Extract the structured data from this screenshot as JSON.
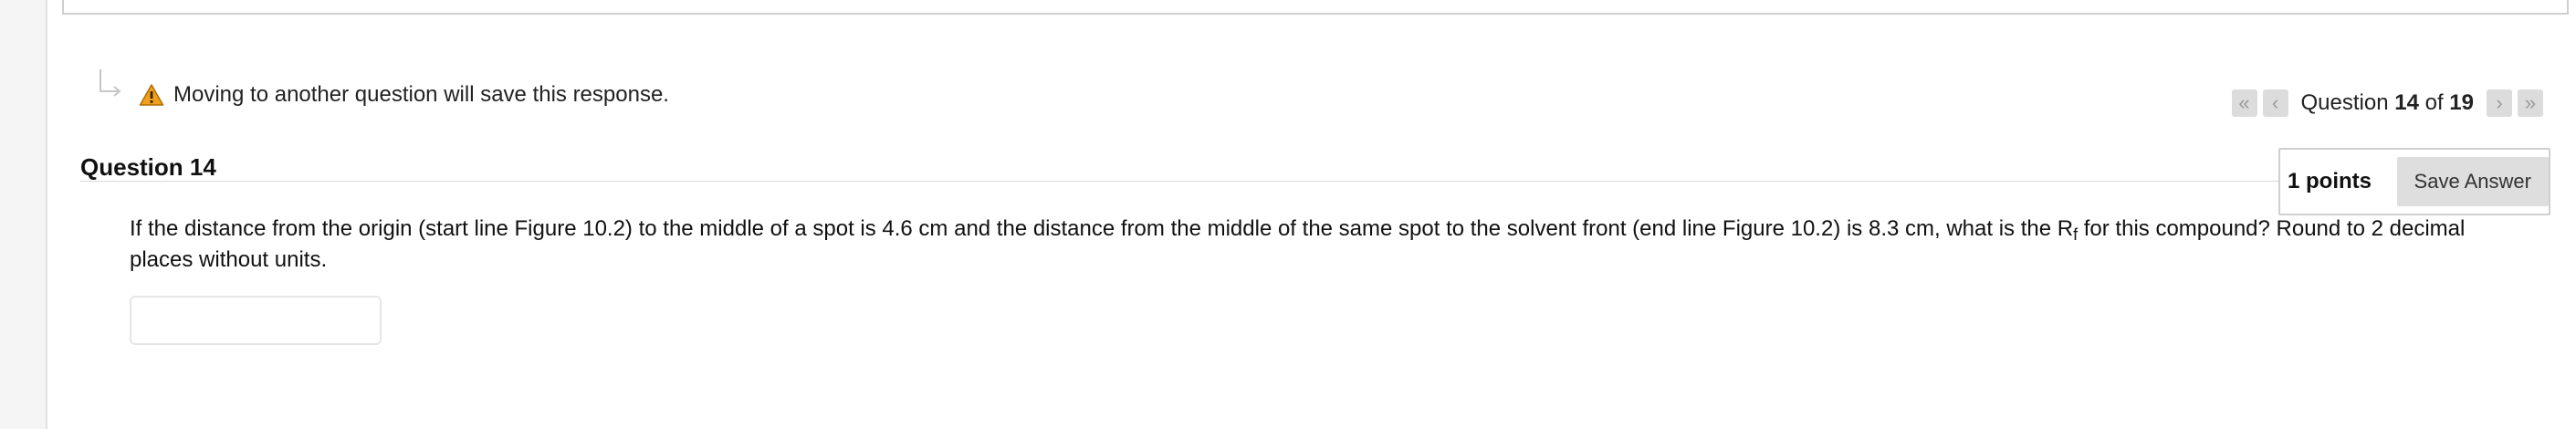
{
  "warning": {
    "text": "Moving to another question will save this response.",
    "icon": "warning-triangle",
    "icon_color": "#f0a020"
  },
  "pager": {
    "prefix": "Question",
    "current": "14",
    "of_label": "of",
    "total": "19",
    "first_icon": "double-chevron-left",
    "prev_icon": "chevron-left",
    "next_icon": "chevron-right",
    "last_icon": "double-chevron-right"
  },
  "question": {
    "title": "Question 14",
    "points": "1 points",
    "save_label": "Save Answer",
    "text_before_sub": "If the distance from the origin (start line Figure 10.2) to the middle of a spot is 4.6 cm and the distance from the middle of the same spot to the solvent front (end line Figure 10.2) is 8.3 cm, what is the R",
    "subscript": "f",
    "text_after_sub": " for this compound?  Round to 2 decimal places without units.",
    "answer_value": ""
  }
}
